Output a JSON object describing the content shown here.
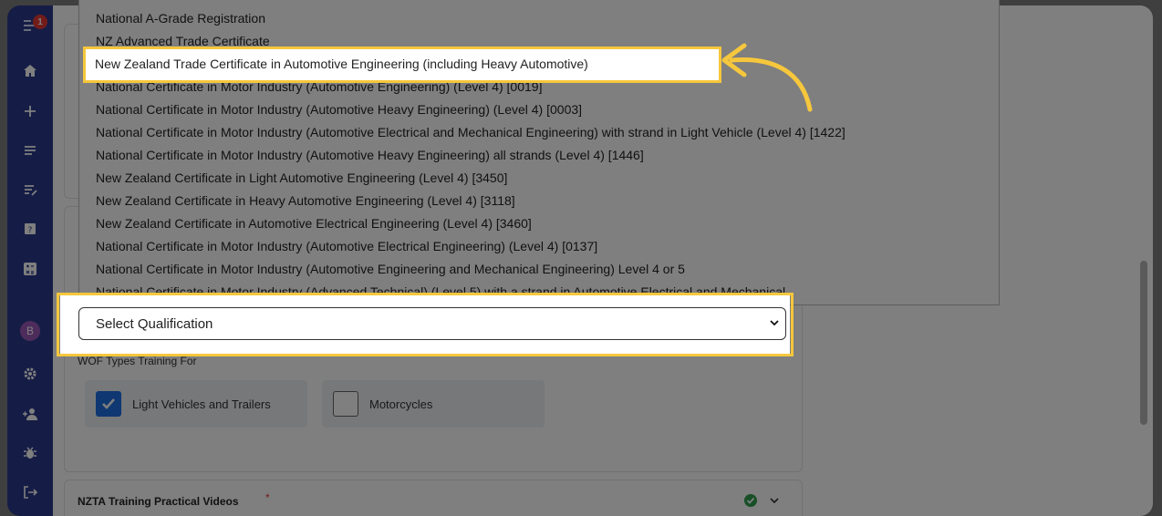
{
  "sidebar": {
    "notification_count": "1",
    "avatar_initial": "B"
  },
  "dropdown": {
    "options": [
      "National A-Grade Registration",
      "NZ Advanced Trade Certificate",
      "New Zealand Trade Certificate in Automotive Engineering (including Heavy Automotive)",
      "National Certificate in Motor Industry (Automotive Engineering) (Level 4) [0019]",
      "National Certificate in Motor Industry (Automotive Heavy Engineering) (Level 4) [0003]",
      "National Certificate in Motor Industry (Automotive Electrical and Mechanical Engineering) with strand in Light Vehicle (Level 4) [1422]",
      "National Certificate in Motor Industry (Automotive Heavy Engineering) all strands (Level 4) [1446]",
      "New Zealand Certificate in Light Automotive Engineering (Level 4) [3450]",
      "New Zealand Certificate in Heavy Automotive Engineering (Level 4) [3118]",
      "New Zealand Certificate in Automotive Electrical Engineering (Level 4) [3460]",
      "National Certificate in Motor Industry (Automotive Electrical Engineering) (Level 4) [0137]",
      "National Certificate in Motor Industry (Automotive Engineering and Mechanical Engineering) Level 4 or 5",
      "National Certificate in Motor Industry (Advanced Technical) (Level 5) with a strand in Automotive Electrical and Mechanical"
    ],
    "highlighted_index": 2
  },
  "qualification_select": {
    "value": "Select Qualification"
  },
  "wof": {
    "label": "WOF Types Training For",
    "options": [
      {
        "label": "Light Vehicles and Trailers",
        "checked": true
      },
      {
        "label": "Motorcycles",
        "checked": false
      }
    ]
  },
  "nzta_section": {
    "title": "NZTA Training Practical Videos",
    "required_mark": "*"
  },
  "colors": {
    "sidebar": "#2b3a8c",
    "highlight": "#f6c73c",
    "checkbox": "#1f6fe5",
    "success": "#2e9e4f",
    "required": "#e53935"
  }
}
